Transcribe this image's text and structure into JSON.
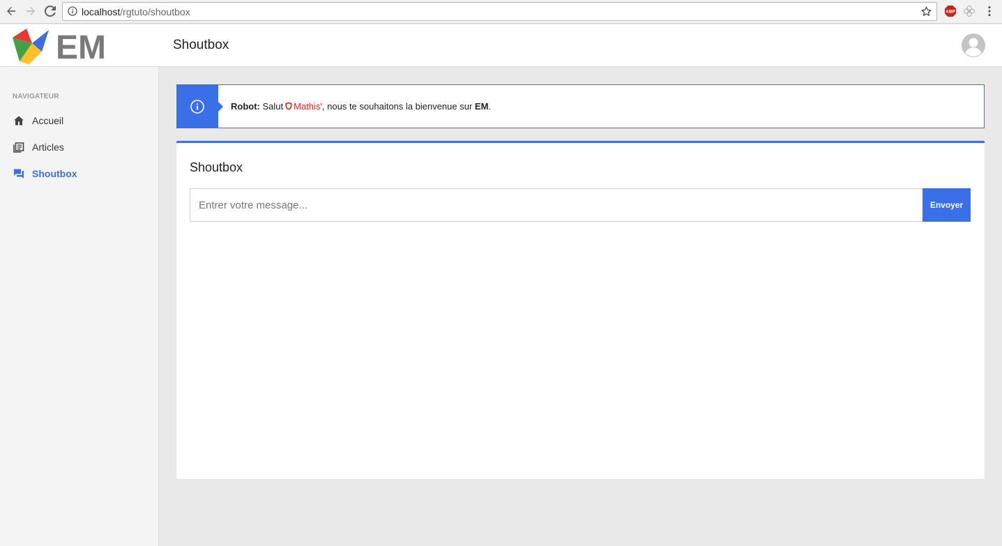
{
  "browser": {
    "url_host": "localhost",
    "url_path": "/rgtuto/shoutbox",
    "extension_abp_label": "ABP"
  },
  "header": {
    "logo_text": "EM",
    "page_title": "Shoutbox"
  },
  "sidebar": {
    "heading": "NAVIGATEUR",
    "items": [
      {
        "label": "Accueil",
        "icon": "home-icon",
        "active": false
      },
      {
        "label": "Articles",
        "icon": "articles-icon",
        "active": false
      },
      {
        "label": "Shoutbox",
        "icon": "chat-icon",
        "active": true
      }
    ]
  },
  "alert": {
    "sender": "Robot:",
    "greeting": "Salut",
    "username": "Mathis'",
    "message_middle": ", nous te souhaitons la bienvenue sur",
    "site": "EM",
    "end": "."
  },
  "card": {
    "title": "Shoutbox",
    "input_placeholder": "Entrer votre message...",
    "input_value": "",
    "send_label": "Envoyer"
  },
  "colors": {
    "accent": "#3a6fe8",
    "username": "#d42a1e"
  }
}
